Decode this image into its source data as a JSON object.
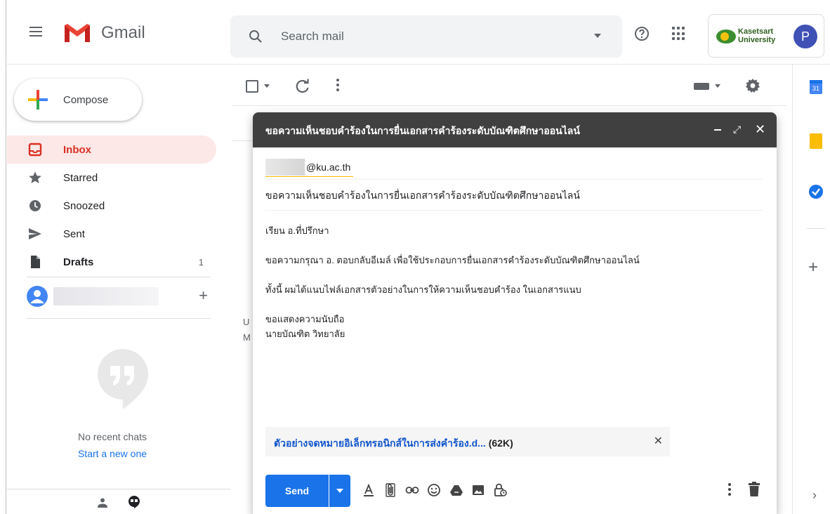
{
  "header": {
    "app_name": "Gmail",
    "search_placeholder": "Search mail",
    "org_line1": "Kasetsart",
    "org_line2": "University",
    "avatar_letter": "P"
  },
  "sidebar": {
    "compose_label": "Compose",
    "items": [
      {
        "label": "Inbox",
        "count": "",
        "active": true,
        "icon": "inbox-icon"
      },
      {
        "label": "Starred",
        "count": "",
        "icon": "star-icon"
      },
      {
        "label": "Snoozed",
        "count": "",
        "icon": "clock-icon"
      },
      {
        "label": "Sent",
        "count": "",
        "icon": "send-icon"
      },
      {
        "label": "Drafts",
        "count": "1",
        "icon": "draft-icon"
      }
    ],
    "no_chats": "No recent chats",
    "start_new": "Start a new one"
  },
  "main": {
    "partial_line1": "U",
    "partial_line2": "M"
  },
  "compose": {
    "title": "ขอความเห็นชอบคำร้องในการยื่นเอกสารคำร้องระดับบัณฑิตศึกษาออนไลน์",
    "recipient_suffix": "@ku.ac.th",
    "subject": "ขอความเห็นชอบคำร้องในการยื่นเอกสารคำร้องระดับบัณฑิตศึกษาออนไลน์",
    "body": {
      "greeting": "เรียน อ.ที่ปรึกษา",
      "line1": "ขอความกรุณา อ. ตอบกลับอีเมล์ เพื่อใช้ประกอบการยื่นเอกสารคำร้องระดับบัณฑิตศึกษาออนไลน์",
      "line2": "ทั้งนี้ ผมได้แนบไฟล์เอกสารตัวอย่างในการให้ความเห็นชอบคำร้อง ในเอกสารแนบ",
      "closing": "ขอแสดงความนับถือ",
      "signature": "นายบัณฑิต วิทยาลัย"
    },
    "attachment": {
      "name": "ตัวอย่างจดหมายอิเล็กทรอนิกส์ในการส่งคำร้อง.d...",
      "size": "(62K)"
    },
    "send_label": "Send"
  },
  "colors": {
    "accent": "#1a73e8",
    "inbox_active_bg": "#fce8e6",
    "inbox_active_text": "#d93025",
    "titlebar": "#404040"
  }
}
